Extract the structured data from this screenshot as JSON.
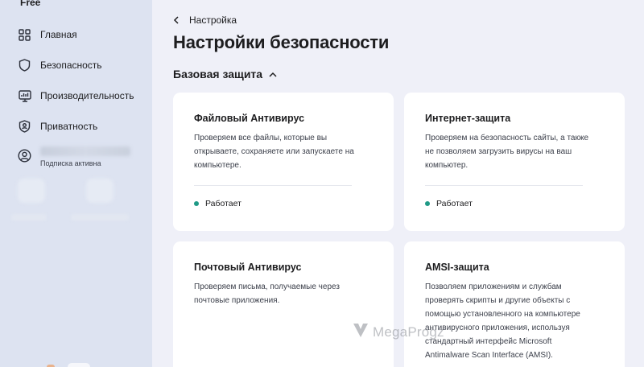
{
  "app": {
    "name": "Free"
  },
  "sidebar": {
    "items": [
      {
        "label": "Главная",
        "icon": "home-grid-icon"
      },
      {
        "label": "Безопасность",
        "icon": "shield-icon"
      },
      {
        "label": "Производительность",
        "icon": "monitor-icon"
      },
      {
        "label": "Приватность",
        "icon": "privacy-shield-icon"
      }
    ],
    "account": {
      "subtitle": "Подписка активна",
      "icon": "user-icon"
    }
  },
  "header": {
    "breadcrumb": "Настройка",
    "title": "Настройки безопасности"
  },
  "section": {
    "label": "Базовая защита",
    "expanded": true
  },
  "cards": [
    {
      "title": "Файловый Антивирус",
      "desc": [
        "Проверяем все файлы, которые вы",
        "открываете, сохраняете или запускаете на",
        "компьютере."
      ],
      "status": "Работает"
    },
    {
      "title": "Интернет-защита",
      "desc": [
        "Проверяем на безопасность сайты, а также",
        "не позволяем загрузить вирусы на ваш",
        "компьютер."
      ],
      "status": "Работает"
    },
    {
      "title": "Почтовый Антивирус",
      "desc": [
        "Проверяем письма, получаемые через",
        "почтовые приложения."
      ]
    },
    {
      "title": "AMSI-защита",
      "desc": [
        "Позволяем приложениям и службам",
        "проверять скрипты и другие объекты с",
        "помощью установленного на компьютере",
        "антивирусного приложения, используя",
        "стандартный интерфейс Microsoft",
        "Antimalware Scan Interface (AMSI)."
      ]
    }
  ],
  "colors": {
    "accent": "#1f9a86",
    "background": "#eff0f8",
    "sidebar": "#dde3f1",
    "card": "#ffffff"
  },
  "watermark": "MegaProgz"
}
